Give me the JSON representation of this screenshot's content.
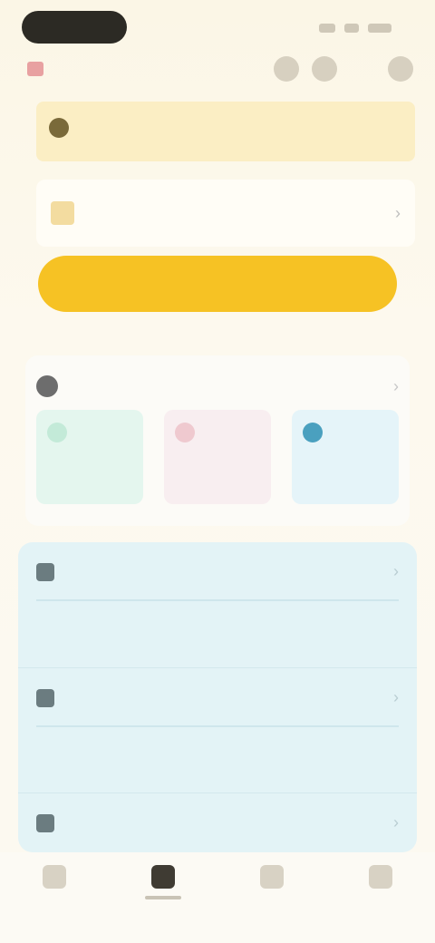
{
  "status_bar": {
    "pill": ""
  },
  "notice": {
    "text": ""
  },
  "card": {
    "line1": "",
    "line2": ""
  },
  "primary_button": {
    "label": ""
  },
  "section": {
    "title": "",
    "tiles": [
      {
        "label": ""
      },
      {
        "label": ""
      },
      {
        "label": ""
      }
    ]
  },
  "list": {
    "rows": [
      {
        "title": "",
        "subtitle": "",
        "description": ""
      },
      {
        "title": "",
        "subtitle": "",
        "description": ""
      },
      {
        "title": "",
        "subtitle": "",
        "description": ""
      }
    ]
  },
  "tabbar": {
    "tabs": [
      {
        "icon": "home-icon",
        "active": false
      },
      {
        "icon": "grid-icon",
        "active": true
      },
      {
        "icon": "bell-icon",
        "active": false
      },
      {
        "icon": "profile-icon",
        "active": false
      }
    ]
  },
  "colors": {
    "accent": "#f6c224",
    "notice_bg": "#fbeec4",
    "list_bg": "#e3f3f6"
  }
}
